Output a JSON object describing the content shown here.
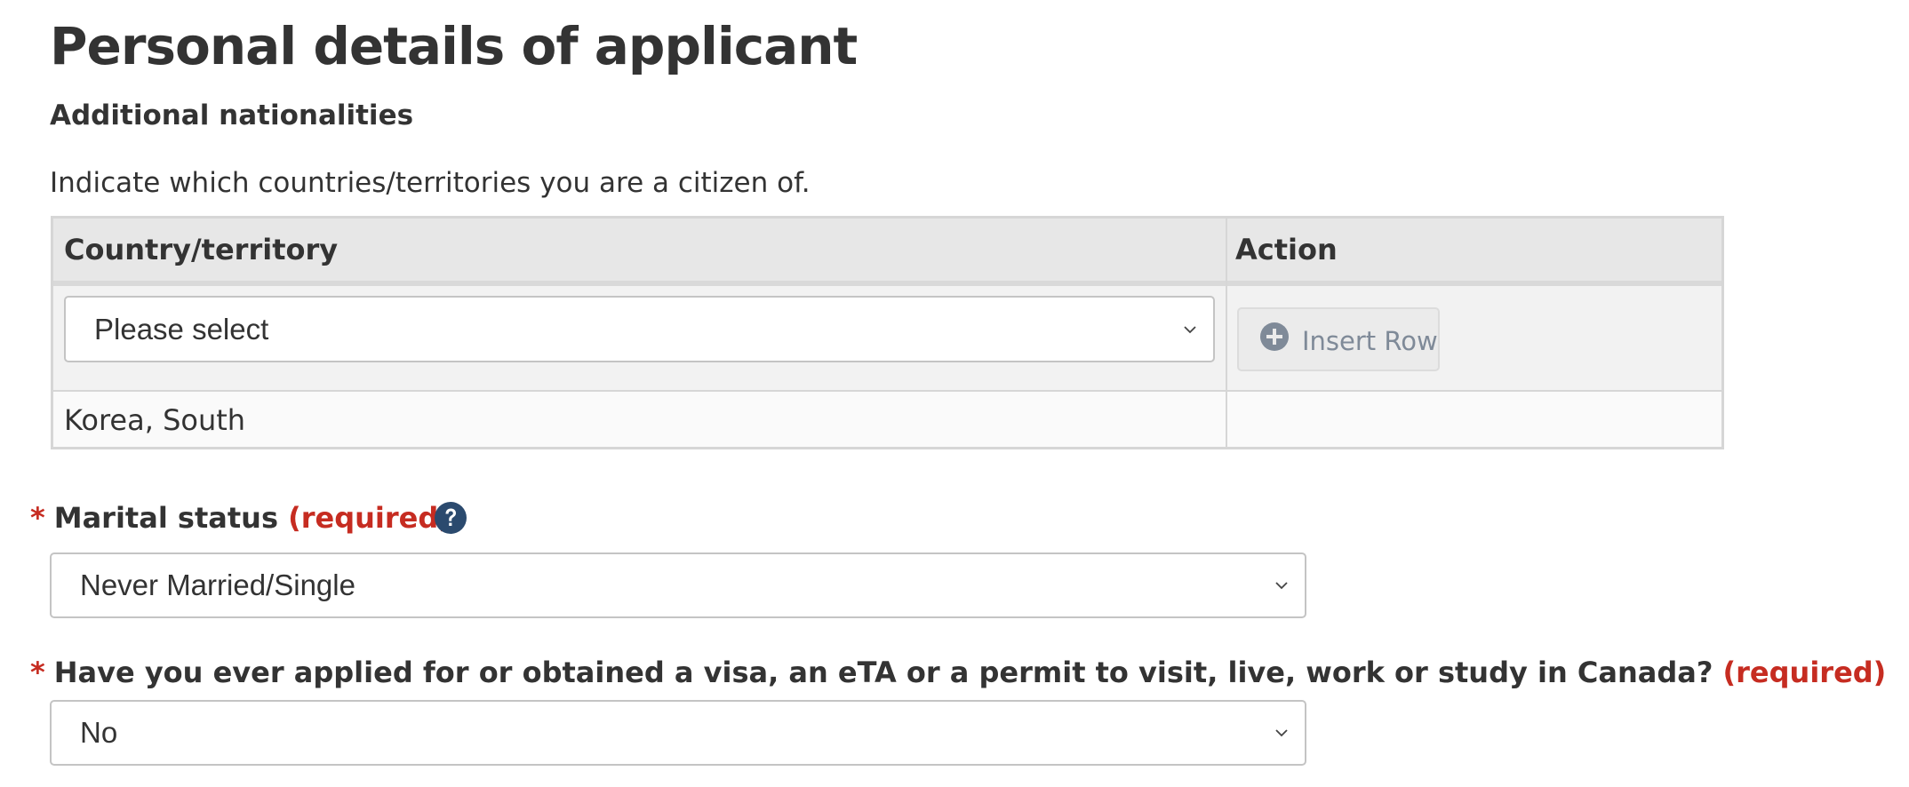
{
  "page_title": "Personal details of applicant",
  "additional_nationalities": {
    "heading": "Additional nationalities",
    "instructions": "Indicate which countries/territories you are a citizen of.",
    "table": {
      "columns": [
        "Country/territory",
        "Action"
      ],
      "entry_row": {
        "country_select_value": "Please select",
        "insert_button_label": "Insert Row",
        "insert_button_icon": "plus-circle-icon"
      },
      "rows": [
        {
          "country": "Korea, South",
          "action": ""
        }
      ]
    }
  },
  "marital_status": {
    "label": "Marital status",
    "required_marker": "*",
    "required_text": "(required)",
    "help_icon": "question-circle-icon",
    "selected_value": "Never Married/Single"
  },
  "previous_application": {
    "label": "Have you ever applied for or obtained a visa, an eTA or a permit to visit, live, work or study in Canada?",
    "required_marker": "*",
    "required_text": "(required)",
    "selected_value": "No"
  },
  "colors": {
    "text": "#333333",
    "required_red": "#c62c21",
    "help_icon_navy": "#2b4a6e",
    "button_icon_gray": "#7f8a98",
    "table_header_bg": "#e7e7e7"
  }
}
